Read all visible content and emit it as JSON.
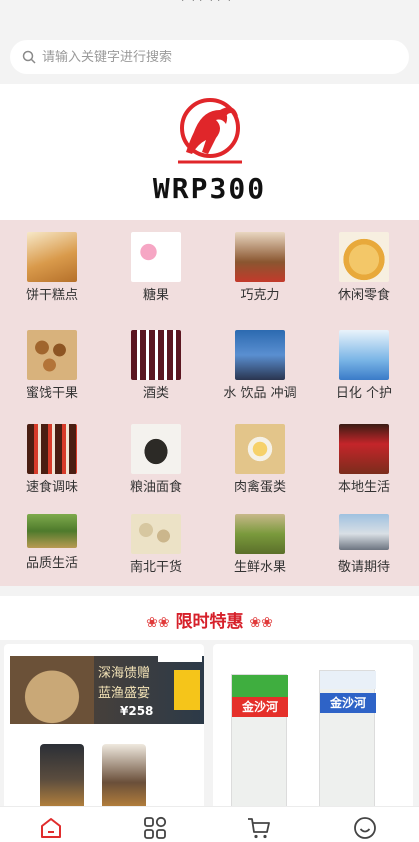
{
  "search": {
    "placeholder": "请输入关键字进行搜索"
  },
  "brand": {
    "logo_text": "WRP300"
  },
  "categories": [
    {
      "label": "饼干糕点"
    },
    {
      "label": "糖果"
    },
    {
      "label": "巧克力"
    },
    {
      "label": "休闲零食"
    },
    {
      "label": "蜜饯干果"
    },
    {
      "label": "酒类"
    },
    {
      "label": "水 饮品 冲调"
    },
    {
      "label": "日化 个护"
    },
    {
      "label": "速食调味"
    },
    {
      "label": "粮油面食"
    },
    {
      "label": "肉禽蛋类"
    },
    {
      "label": "本地生活"
    },
    {
      "label": "品质生活"
    },
    {
      "label": "南北干货"
    },
    {
      "label": "生鲜水果"
    },
    {
      "label": "敬请期待"
    }
  ],
  "promo": {
    "title": "限时特惠"
  },
  "products": {
    "left_ad": {
      "line1": "深海馈赠",
      "line2": "蓝渔盛宴",
      "price": "¥258"
    },
    "right_brand": "金沙河"
  },
  "nav": {
    "items": [
      {
        "icon": "home-icon"
      },
      {
        "icon": "category-icon"
      },
      {
        "icon": "cart-icon"
      },
      {
        "icon": "profile-icon"
      }
    ]
  },
  "colors": {
    "accent": "#e02d2d",
    "category_bg": "#f1dede",
    "promo_red": "#d6202a"
  }
}
